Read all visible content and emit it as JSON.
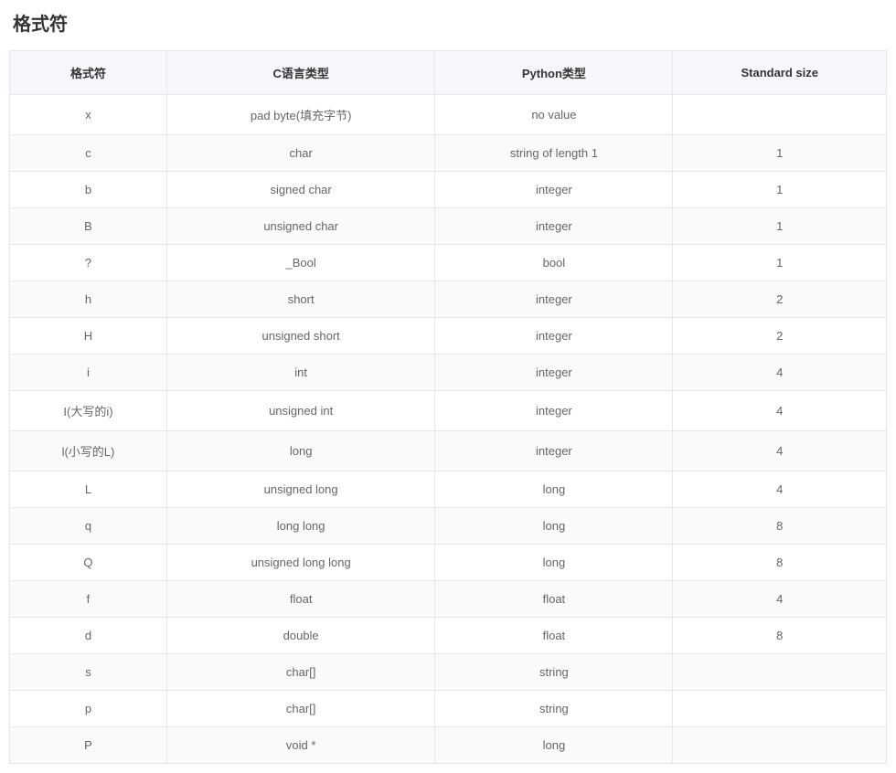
{
  "heading": "格式符",
  "table": {
    "headers": [
      "格式符",
      "C语言类型",
      "Python类型",
      "Standard size"
    ],
    "rows": [
      {
        "cells": [
          "x",
          "pad byte(填充字节)",
          "no value",
          ""
        ]
      },
      {
        "cells": [
          "c",
          "char",
          "string of length 1",
          "1"
        ]
      },
      {
        "cells": [
          "b",
          "signed char",
          "integer",
          "1"
        ]
      },
      {
        "cells": [
          "B",
          "unsigned char",
          "integer",
          "1"
        ]
      },
      {
        "cells": [
          "?",
          "_Bool",
          "bool",
          "1"
        ]
      },
      {
        "cells": [
          "h",
          "short",
          "integer",
          "2"
        ]
      },
      {
        "cells": [
          "H",
          "unsigned short",
          "integer",
          "2"
        ]
      },
      {
        "cells": [
          "i",
          "int",
          "integer",
          "4"
        ]
      },
      {
        "cells": [
          "I(大写的i)",
          "unsigned int",
          "integer",
          "4"
        ]
      },
      {
        "cells": [
          "l(小写的L)",
          "long",
          "integer",
          "4"
        ]
      },
      {
        "cells": [
          "L",
          "unsigned long",
          "long",
          "4"
        ]
      },
      {
        "cells": [
          "q",
          "long long",
          "long",
          "8"
        ]
      },
      {
        "cells": [
          "Q",
          "unsigned long long",
          "long",
          "8"
        ]
      },
      {
        "cells": [
          "f",
          "float",
          "float",
          "4"
        ]
      },
      {
        "cells": [
          "d",
          "double",
          "float",
          "8"
        ]
      },
      {
        "cells": [
          "s",
          "char[]",
          "string",
          ""
        ]
      },
      {
        "cells": [
          "p",
          "char[]",
          "string",
          ""
        ]
      },
      {
        "cells": [
          "P",
          "void *",
          "long",
          ""
        ]
      }
    ]
  }
}
